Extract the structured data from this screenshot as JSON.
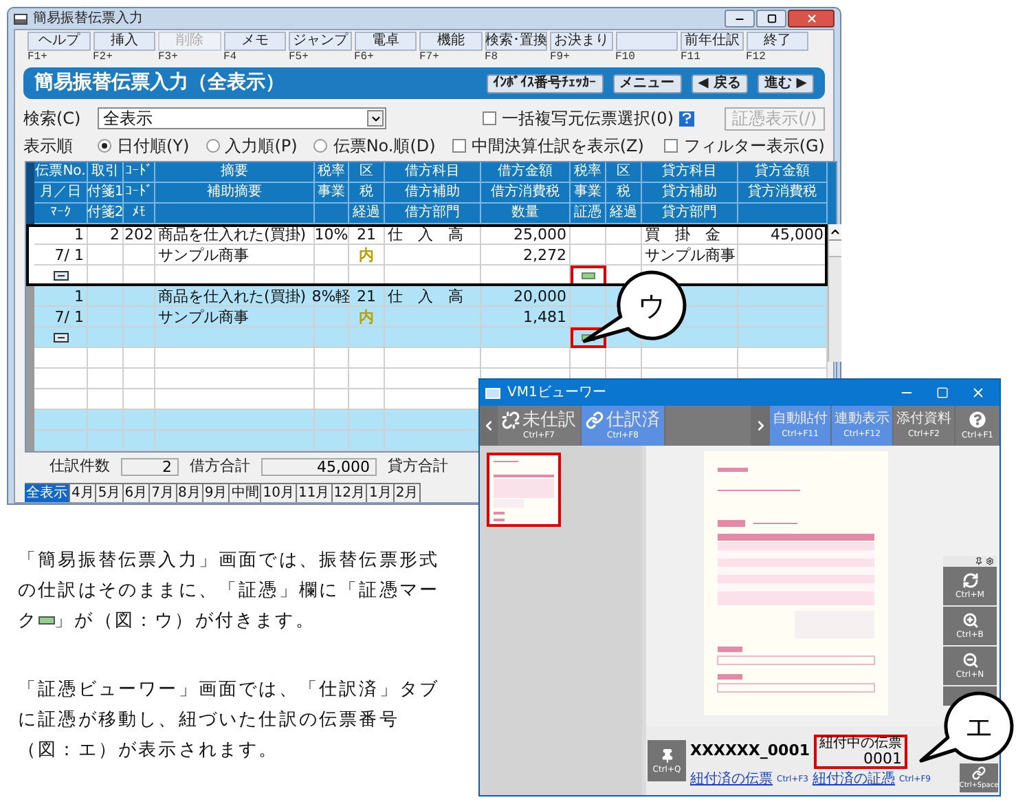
{
  "main_window": {
    "title": "簡易振替伝票入力",
    "function_keys": [
      {
        "label": "ヘルプ",
        "key": "F1+",
        "disabled": false
      },
      {
        "label": "挿入",
        "key": "F2+",
        "disabled": false
      },
      {
        "label": "削除",
        "key": "F3+",
        "disabled": true
      },
      {
        "label": "メモ",
        "key": "F4",
        "disabled": false
      },
      {
        "label": "ジャンプ",
        "key": "F5+",
        "disabled": false
      },
      {
        "label": "電卓",
        "key": "F6+",
        "disabled": false
      },
      {
        "label": "機能",
        "key": "F7+",
        "disabled": false
      },
      {
        "label": "検索･置換",
        "key": "F8",
        "disabled": false
      },
      {
        "label": "お決まり",
        "key": "F9+",
        "disabled": false
      },
      {
        "key": "F10",
        "disabled": false
      },
      {
        "label": "前年仕訳",
        "key": "F11",
        "disabled": false
      },
      {
        "label": "終了",
        "key": "F12",
        "disabled": false
      }
    ],
    "banner": {
      "title": "簡易振替伝票入力（全表示）",
      "buttons": [
        "ｲﾝﾎﾞｲｽ番号ﾁｪｯｶｰ",
        "メニュー",
        "◀ 戻る",
        "進む ▶"
      ]
    },
    "search": {
      "label": "検索(C)",
      "value": "全表示"
    },
    "bulk_copy": {
      "label": "一括複写元伝票選択(0)",
      "checked": false
    },
    "evidence_button": {
      "label": "証憑表示(/)",
      "disabled": true
    },
    "sort": {
      "label": "表示順",
      "options": [
        {
          "label": "日付順(Y)",
          "selected": true
        },
        {
          "label": "入力順(P)",
          "selected": false
        },
        {
          "label": "伝票No.順(D)",
          "selected": false
        }
      ]
    },
    "interim": {
      "label": "中間決算仕訳を表示(Z)",
      "checked": false
    },
    "filter": {
      "label": "フィルター表示(G)",
      "checked": false
    },
    "grid": {
      "columns": [
        {
          "headers": [
            "伝票No.",
            "月／日",
            "ﾏｰｸ"
          ]
        },
        {
          "headers": [
            "取引",
            "付箋1",
            "付箋2"
          ]
        },
        {
          "headers": [
            "ｺｰﾄﾞ",
            "ｺｰﾄﾞ",
            "ﾒﾓ"
          ]
        },
        {
          "headers": [
            "摘要",
            "補助摘要"
          ]
        },
        {
          "headers": [
            "税率",
            "事業"
          ]
        },
        {
          "headers": [
            "区",
            "税",
            "経過"
          ]
        },
        {
          "headers": [
            "借方科目",
            "借方補助",
            "借方部門"
          ]
        },
        {
          "headers": [
            "借方金額",
            "借方消費税",
            "数量"
          ]
        },
        {
          "headers": [
            "税率",
            "事業",
            "証憑"
          ]
        },
        {
          "headers": [
            "区",
            "税",
            "経過"
          ]
        },
        {
          "headers": [
            "貸方科目",
            "貸方補助",
            "貸方部門"
          ]
        },
        {
          "headers": [
            "貸方金額",
            "貸方消費税"
          ]
        }
      ],
      "entries": [
        {
          "selected": true,
          "memo_mark": true,
          "evidence_mark": true,
          "highlighted": true,
          "rows": [
            {
              "0": "1",
              "1": "2",
              "2": "202",
              "3": "商品を仕入れた(買掛)",
              "4": "10%",
              "5": "21",
              "6": "仕　入　高",
              "7": "25,000",
              "10": "買　掛　金",
              "11": "45,000"
            },
            {
              "0": "7/ 1",
              "3": "サンプル商事",
              "5": "内",
              "7": "2,272",
              "10": "サンプル商事"
            }
          ]
        },
        {
          "selected": false,
          "memo_mark": true,
          "evidence_mark": true,
          "highlighted": true,
          "rows": [
            {
              "0": "1",
              "3": "商品を仕入れた(買掛)",
              "4": "8%軽",
              "5": "21",
              "6": "仕　入　高",
              "7": "20,000"
            },
            {
              "0": "7/ 1",
              "3": "サンプル商事",
              "5": "内",
              "7": "1,481"
            }
          ]
        }
      ]
    },
    "totals": {
      "count_label": "仕訳件数",
      "count": "2",
      "debit_label": "借方合計",
      "debit": "45,000",
      "credit_label": "貸方合計"
    },
    "month_tabs": [
      {
        "label": "全表示",
        "selected": true
      },
      {
        "label": "4月",
        "selected": false
      },
      {
        "label": "5月",
        "selected": false
      },
      {
        "label": "6月",
        "selected": false
      },
      {
        "label": "7月",
        "selected": false
      },
      {
        "label": "8月",
        "selected": false
      },
      {
        "label": "9月",
        "selected": false
      },
      {
        "label": "中間",
        "selected": false
      },
      {
        "label": "10月",
        "selected": false
      },
      {
        "label": "11月",
        "selected": false
      },
      {
        "label": "12月",
        "selected": false
      },
      {
        "label": "1月",
        "selected": false
      },
      {
        "label": "2月",
        "selected": false
      }
    ]
  },
  "notes": [
    {
      "before": "「簡易振替伝票入力」画面では、振替伝票形式の仕訳はそのままに、「証憑」欄に「証憑マーク",
      "after": "」が（図：ウ）が付きます。"
    },
    {
      "text": "「証憑ビューワー」画面では、「仕訳済」タブに証憑が移動し、紐づいた仕訳の伝票番号（図：エ）が表示されます。"
    }
  ],
  "viewer": {
    "title": "VM1ビューワー",
    "tabs": [
      {
        "kind": "unlinked",
        "label": "未仕訳",
        "shortcut": "Ctrl+F7",
        "selected": false
      },
      {
        "kind": "linked",
        "label": "仕訳済",
        "shortcut": "Ctrl+F8",
        "selected": true
      }
    ],
    "actions": [
      {
        "kind": "text",
        "label": "自動貼付",
        "shortcut": "Ctrl+F11",
        "on": true
      },
      {
        "kind": "text",
        "label": "連動表示",
        "shortcut": "Ctrl+F12",
        "on": true
      },
      {
        "kind": "text",
        "label": "添付資料",
        "shortcut": "Ctrl+F2",
        "on": false
      },
      {
        "kind": "help",
        "shortcut": "Ctrl+F1",
        "on": false
      }
    ],
    "side_tools": [
      {
        "kind": "refresh",
        "shortcut": "Ctrl+M"
      },
      {
        "kind": "zoom_in",
        "shortcut": "Ctrl+B"
      },
      {
        "kind": "zoom_out",
        "shortcut": "Ctrl+N"
      }
    ],
    "pin_shortcut": "Ctrl+Q",
    "slip_id": "XXXXXX_0001",
    "current_label": "紐付中の伝票",
    "current_value": "0001",
    "current_highlighted": true,
    "links": [
      {
        "label": "紐付済の伝票",
        "shortcut": "Ctrl+F3"
      },
      {
        "label": "紐付済の証憑",
        "shortcut": "Ctrl+F9"
      }
    ],
    "link_button_shortcut": "Ctrl+Space"
  },
  "callouts": [
    {
      "label": "ウ"
    },
    {
      "label": "エ"
    }
  ]
}
